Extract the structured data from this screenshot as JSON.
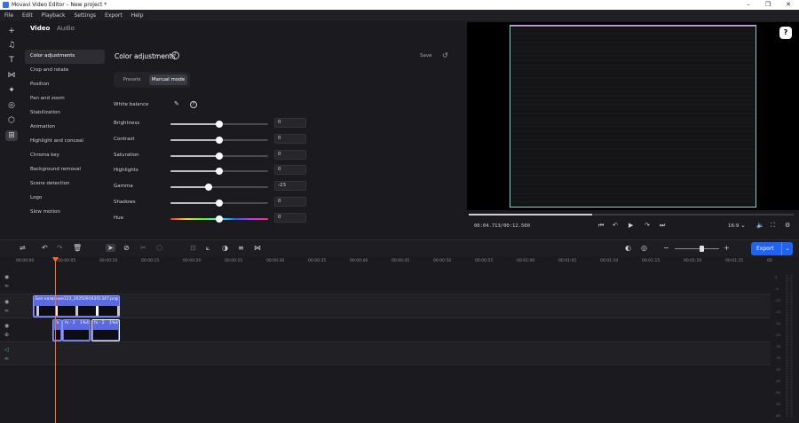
{
  "window": {
    "title": "Movavi Video Editor – New project *"
  },
  "menu": [
    "File",
    "Edit",
    "Playback",
    "Settings",
    "Export",
    "Help"
  ],
  "tabs": {
    "video": "Video",
    "audio": "Audio"
  },
  "sidenav": [
    "Color adjustments",
    "Crop and rotate",
    "Position",
    "Pan and zoom",
    "Stabilization",
    "Animation",
    "Highlight and conceal",
    "Chroma key",
    "Background removal",
    "Scene detection",
    "Logo",
    "Slow motion"
  ],
  "panel": {
    "title": "Color adjustments",
    "save": "Save",
    "presets": "Presets",
    "manual": "Manual mode",
    "white_balance": "White balance",
    "sliders": [
      {
        "label": "Brightness",
        "value": "0",
        "pos": 0.5
      },
      {
        "label": "Contrast",
        "value": "0",
        "pos": 0.5
      },
      {
        "label": "Saturation",
        "value": "0",
        "pos": 0.5
      },
      {
        "label": "Highlights",
        "value": "0",
        "pos": 0.5
      },
      {
        "label": "Gamma",
        "value": "-23",
        "pos": 0.39
      },
      {
        "label": "Shadows",
        "value": "0",
        "pos": 0.5
      },
      {
        "label": "Hue",
        "value": "0",
        "pos": 0.5
      }
    ]
  },
  "player": {
    "time": "00:04.713/00:12.500",
    "progress": 0.38,
    "ratio": "16:9"
  },
  "timeline": {
    "export": "Export",
    "ruler": [
      "00:00:00",
      "00:00:05",
      "00:00:10",
      "00:00:15",
      "00:00:20",
      "00:00:25",
      "00:00:30",
      "00:00:35",
      "00:00:40",
      "00:00:45",
      "00:00:50",
      "00:00:55",
      "00:01:00",
      "00:01:05",
      "00:01:10",
      "00:01:15",
      "00:01:20",
      "00:01:25",
      "00:01:30"
    ],
    "clip_main": "Без названия123_20250916201347.png",
    "clip_fx1": "fx",
    "clip_fx2": "fx - 2",
    "clip_fx2_tag": "1%4",
    "clip_fx3": "fx - 2",
    "clip_fx3_tag": "1%4"
  },
  "meter": [
    "0",
    "-5",
    "-10",
    "-15",
    "-20",
    "-25",
    "-30",
    "-35",
    "-40",
    "-45",
    "-50",
    "-55",
    "-60"
  ]
}
